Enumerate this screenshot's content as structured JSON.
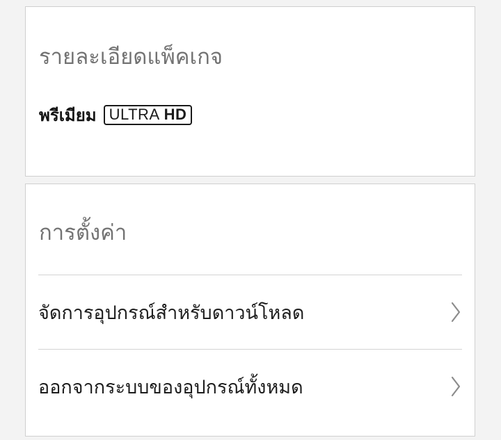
{
  "plan_details": {
    "title": "รายละเอียดแพ็คเกจ",
    "plan_name": "พรีเมียม",
    "badge_light": "ULTRA",
    "badge_bold": "HD"
  },
  "settings": {
    "title": "การตั้งค่า",
    "items": [
      {
        "label": "จัดการอุปกรณ์สำหรับดาวน์โหลด",
        "icon": "chevron-right-icon"
      },
      {
        "label": "ออกจากระบบของอุปกรณ์ทั้งหมด",
        "icon": "chevron-right-icon"
      }
    ]
  },
  "colors": {
    "background": "#f3f3f3",
    "card": "#ffffff",
    "section_title": "#737373",
    "text": "#1e1e1e",
    "chevron": "#8c8c8c"
  }
}
